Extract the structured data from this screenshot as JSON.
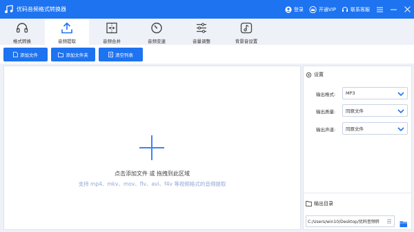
{
  "app": {
    "title": "优码音频格式转换器"
  },
  "titlebar": {
    "login_label": "登录",
    "vip_label": "开通VIP",
    "support_label": "联系客服"
  },
  "tabs": [
    {
      "label": "格式转换",
      "icon": "headphones-icon"
    },
    {
      "label": "音频提取",
      "icon": "upload-icon"
    },
    {
      "label": "音频合并",
      "icon": "merge-icon"
    },
    {
      "label": "音频变速",
      "icon": "speed-dial-icon"
    },
    {
      "label": "音量调整",
      "icon": "sliders-icon"
    },
    {
      "label": "背景音设置",
      "icon": "music-note-icon"
    }
  ],
  "active_tab": "音频提取",
  "toolbar": {
    "add_file": "添加文件",
    "add_folder": "添加文件夹",
    "clear_list": "清空列表"
  },
  "drop": {
    "main_text": "点击添加文件 或 拖拽到此区域",
    "sub_text": "支持 mp4、mkv、mov、flv、avi、f4v 等视频格式的音频提取"
  },
  "settings": {
    "header": "设置",
    "format_label": "输出格式:",
    "format_value": "MP3",
    "quality_label": "输出质量:",
    "quality_value": "同原文件",
    "channel_label": "输出声道:",
    "channel_value": "同原文件"
  },
  "output": {
    "header": "输出目录",
    "path": "C:/Users/win10/Desktop/优码音频转"
  },
  "colors": {
    "accent": "#1e73f0",
    "background": "#eef1f7",
    "drop_hint": "#8fa7d6"
  }
}
